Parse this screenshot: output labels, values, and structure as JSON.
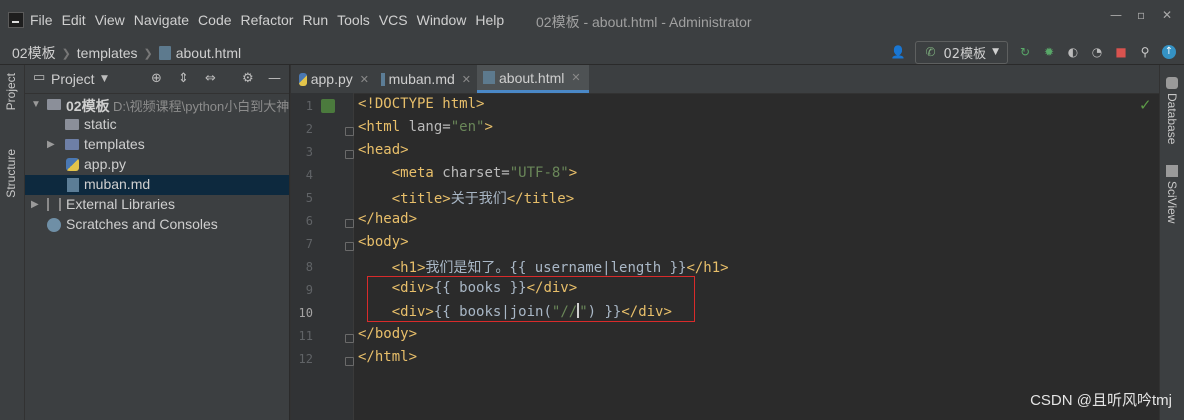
{
  "menubar": {
    "items": [
      "File",
      "Edit",
      "View",
      "Navigate",
      "Code",
      "Refactor",
      "Run",
      "Tools",
      "VCS",
      "Window",
      "Help"
    ],
    "window_title": "02模板 - about.html - Administrator"
  },
  "breadcrumb": {
    "project": "02模板",
    "folder": "templates",
    "file": "about.html"
  },
  "run_config": {
    "label": "02模板"
  },
  "left_tabs": {
    "project": "Project",
    "structure": "Structure"
  },
  "right_tabs": {
    "database": "Database",
    "sciview": "SciView"
  },
  "project_panel": {
    "title": "Project",
    "tree": [
      {
        "label": "02模板",
        "path": "D:\\视频课程\\python小白到大神"
      },
      {
        "label": "static"
      },
      {
        "label": "templates"
      },
      {
        "label": "app.py"
      },
      {
        "label": "muban.md"
      },
      {
        "label": "External Libraries"
      },
      {
        "label": "Scratches and Consoles"
      }
    ]
  },
  "editor": {
    "tabs": [
      "app.py",
      "muban.md",
      "about.html"
    ],
    "active_tab": "about.html",
    "line_numbers": [
      "1",
      "2",
      "3",
      "4",
      "5",
      "6",
      "7",
      "8",
      "9",
      "10",
      "11",
      "12"
    ],
    "lines": {
      "l1": {
        "a": "<!DOCTYPE html>"
      },
      "l2": {
        "a": "<html ",
        "b": "lang=",
        "c": "\"en\"",
        "d": ">"
      },
      "l3": {
        "a": "<head>"
      },
      "l4": {
        "pad": "    ",
        "a": "<meta ",
        "b": "charset=",
        "c": "\"UTF-8\"",
        "d": ">"
      },
      "l5": {
        "pad": "    ",
        "a": "<title>",
        "b": "关于我们",
        "c": "</title>"
      },
      "l6": {
        "a": "</head>"
      },
      "l7": {
        "a": "<body>"
      },
      "l8": {
        "pad": "    ",
        "a": "<h1>",
        "b": "我们是知了。{{ username|length }}",
        "c": "</h1>"
      },
      "l9": {
        "pad": "    ",
        "a": "<div>",
        "b": "{{ books }}",
        "c": "</div>"
      },
      "l10": {
        "pad": "    ",
        "a": "<div>",
        "b": "{{ books|join(",
        "c": "\"//",
        "c2": "\"",
        "d": ") }}",
        "e": "</div>"
      },
      "l11": {
        "a": "</body>"
      },
      "l12": {
        "a": "</html>"
      }
    }
  },
  "watermark": "CSDN @且听风吟tmj",
  "colors": {
    "background": "#2b2b2b",
    "panel": "#3c3f41",
    "tag": "#e8bf6a",
    "string": "#6a8759",
    "highlight_box": "#d92b2b",
    "selection": "#0d293e"
  }
}
